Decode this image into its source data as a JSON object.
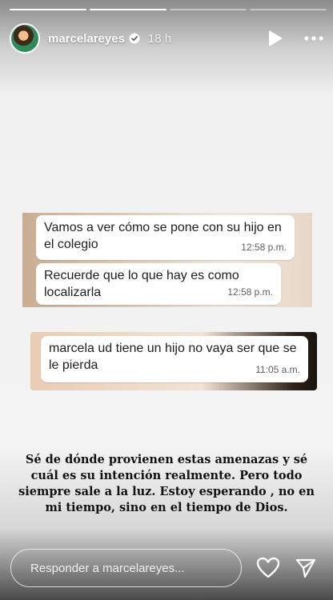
{
  "story": {
    "progress": [
      true,
      true,
      false,
      false
    ]
  },
  "header": {
    "username": "marcelareyes",
    "time": "18 h",
    "icons": [
      "verified-badge-icon",
      "play-icon",
      "more-icon"
    ]
  },
  "chat": {
    "messages": [
      {
        "text": "Vamos a ver cómo se pone con su hijo en el colegio",
        "time": "12:58 p.m."
      },
      {
        "text": "Recuerde que lo que hay es como localizarla",
        "time": "12:58 p.m."
      },
      {
        "text": "marcela ud tiene un hijo no vaya ser que se le pierda",
        "time": "11:05 a.m."
      }
    ]
  },
  "caption": "Sé de dónde provienen estas amenazas y sé cuál es su intención realmente. Pero todo siempre sale a la luz. Estoy esperando , no en mi tiempo, sino en el tiempo de Dios.",
  "reply": {
    "placeholder": "Responder a marcelareyes..."
  },
  "colors": {
    "verified": "#3897f0",
    "text": "#111111"
  }
}
